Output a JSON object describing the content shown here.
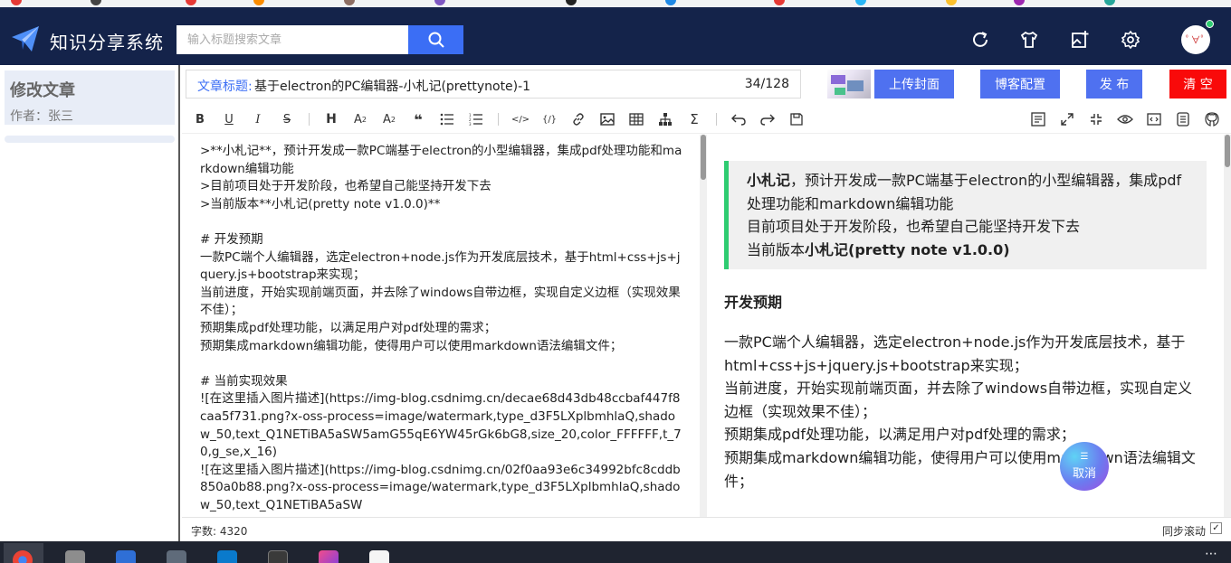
{
  "header": {
    "app_title": "知识分享系统",
    "search_placeholder": "输入标题搜索文章",
    "icons": [
      "refresh-icon",
      "shirt-icon",
      "add-image-icon",
      "gear-icon"
    ],
    "avatar_text": "ﾟ∀ﾟ"
  },
  "left_panel": {
    "title": "修改文章",
    "author": "作者：张三"
  },
  "title_row": {
    "label": "文章标题:",
    "value": "基于electron的PC编辑器-小札记(prettynote)-1",
    "count": "34/128"
  },
  "actions": {
    "upload_cover": "上传封面",
    "blog_config": "博客配置",
    "publish": "发 布",
    "clear": "清 空"
  },
  "toolbar": {
    "heading": "H",
    "subscript": "A",
    "superscript": "A",
    "quote": "❝",
    "code": "</>",
    "code_block": "{/}",
    "sum": "Σ"
  },
  "editor": {
    "content": ">**小札记**，预计开发成一款PC端基于electron的小型编辑器，集成pdf处理功能和markdown编辑功能\n>目前项目处于开发阶段，也希望自己能坚持开发下去\n>当前版本**小札记(pretty note v1.0.0)**\n\n# 开发预期\n一款PC端个人编辑器，选定electron+node.js作为开发底层技术，基于html+css+js+jquery.js+bootstrap来实现；\n当前进度，开始实现前端页面，并去除了windows自带边框，实现自定义边框（实现效果不佳）；\n预期集成pdf处理功能，以满足用户对pdf处理的需求；\n预期集成markdown编辑功能，使得用户可以使用markdown语法编辑文件；\n\n# 当前实现效果\n![在这里插入图片描述](https://img-blog.csdnimg.cn/decae68d43db48ccbaf447f8caa5f731.png?x-oss-process=image/watermark,type_d3F5LXplbmhlaQ,shadow_50,text_Q1NETiBA5aSW5amG55qE6YW45rGk6bG8,size_20,color_FFFFFF,t_70,g_se,x_16)\n![在这里插入图片描述](https://img-blog.csdnimg.cn/02f0aa93e6c34992bfc8cddb850a0b88.png?x-oss-process=image/watermark,type_d3F5LXplbmhlaQ,shadow_50,text_Q1NETiBA5aSW"
  },
  "preview": {
    "quote_bold_1": "小札记",
    "quote_line_1": "，预计开发成一款PC端基于electron的小型编辑器，集成pdf处理功能和markdown编辑功能",
    "quote_line_2": "目前项目处于开发阶段，也希望自己能坚持开发下去",
    "quote_line_3_prefix": "当前版本",
    "quote_bold_2": "小札记(pretty note v1.0.0)",
    "heading": "开发预期",
    "para_1": "一款PC端个人编辑器，选定electron+node.js作为开发底层技术，基于html+css+js+jquery.js+bootstrap来实现；",
    "para_2": "当前进度，开始实现前端页面，并去除了windows自带边框，实现自定义边框（实现效果不佳）；",
    "para_3": "预期集成pdf处理功能，以满足用户对pdf处理的需求；",
    "para_4": "预期集成markdown编辑功能，使得用户可以使用markdown语法编辑文件；"
  },
  "fab": {
    "label": "取消"
  },
  "statusbar": {
    "word_count": "字数: 4320",
    "sync_scroll": "同步滚动"
  },
  "colors": {
    "header_bg": "#14234a",
    "primary_button": "#4f71f0",
    "danger_button": "#f90a0a",
    "quote_border": "#2ecc71"
  }
}
